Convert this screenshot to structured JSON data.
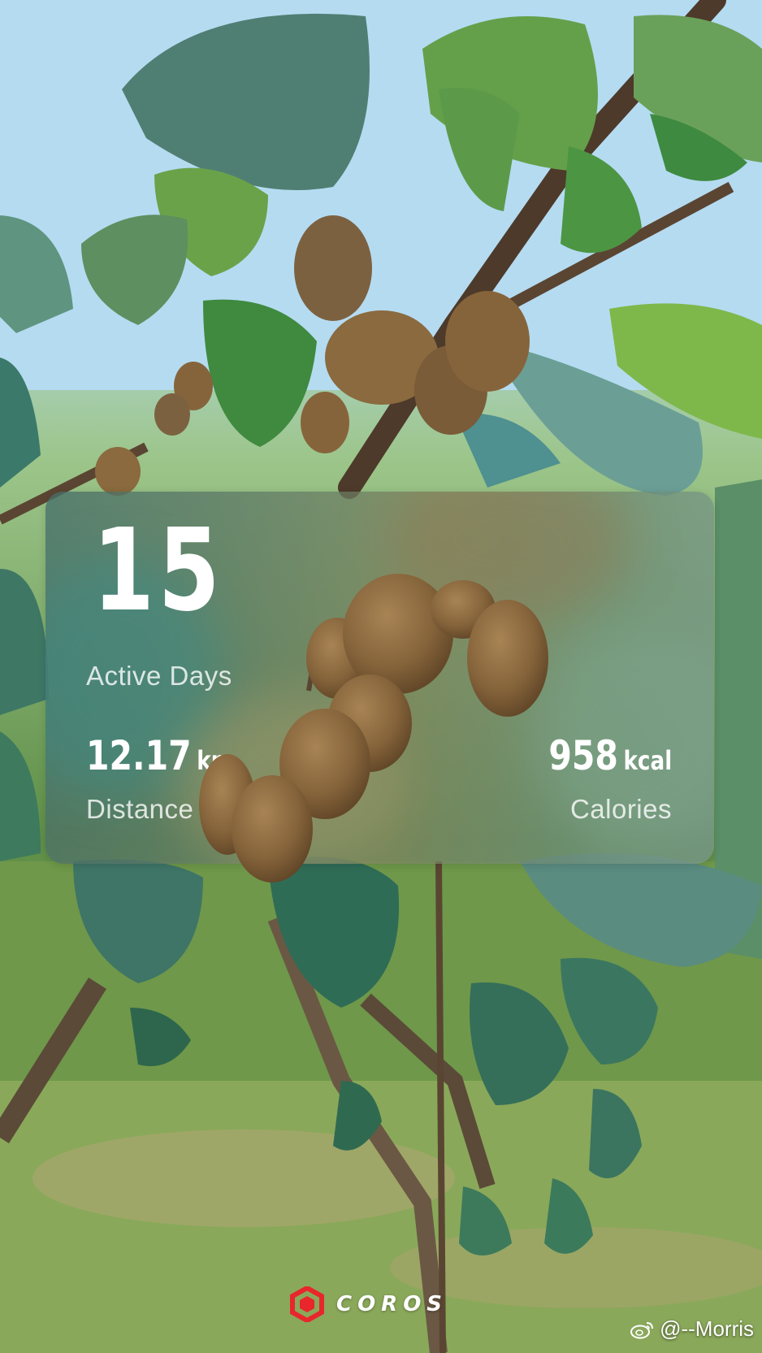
{
  "stats": {
    "active_days_value": "15",
    "active_days_label": "Active Days",
    "distance_value": "12.17",
    "distance_unit": "km",
    "distance_label": "Distance",
    "calories_value": "958",
    "calories_unit": "kcal",
    "calories_label": "Calories"
  },
  "brand": {
    "name": "COROS",
    "logo_color": "#e8262b"
  },
  "watermark": {
    "text": "@--Morris",
    "icon": "weibo-icon"
  },
  "colors": {
    "card_text": "#ffffff",
    "sky": "#a9d3ef",
    "leaf": "#4f7d56",
    "kiwi": "#8a6a3e"
  }
}
